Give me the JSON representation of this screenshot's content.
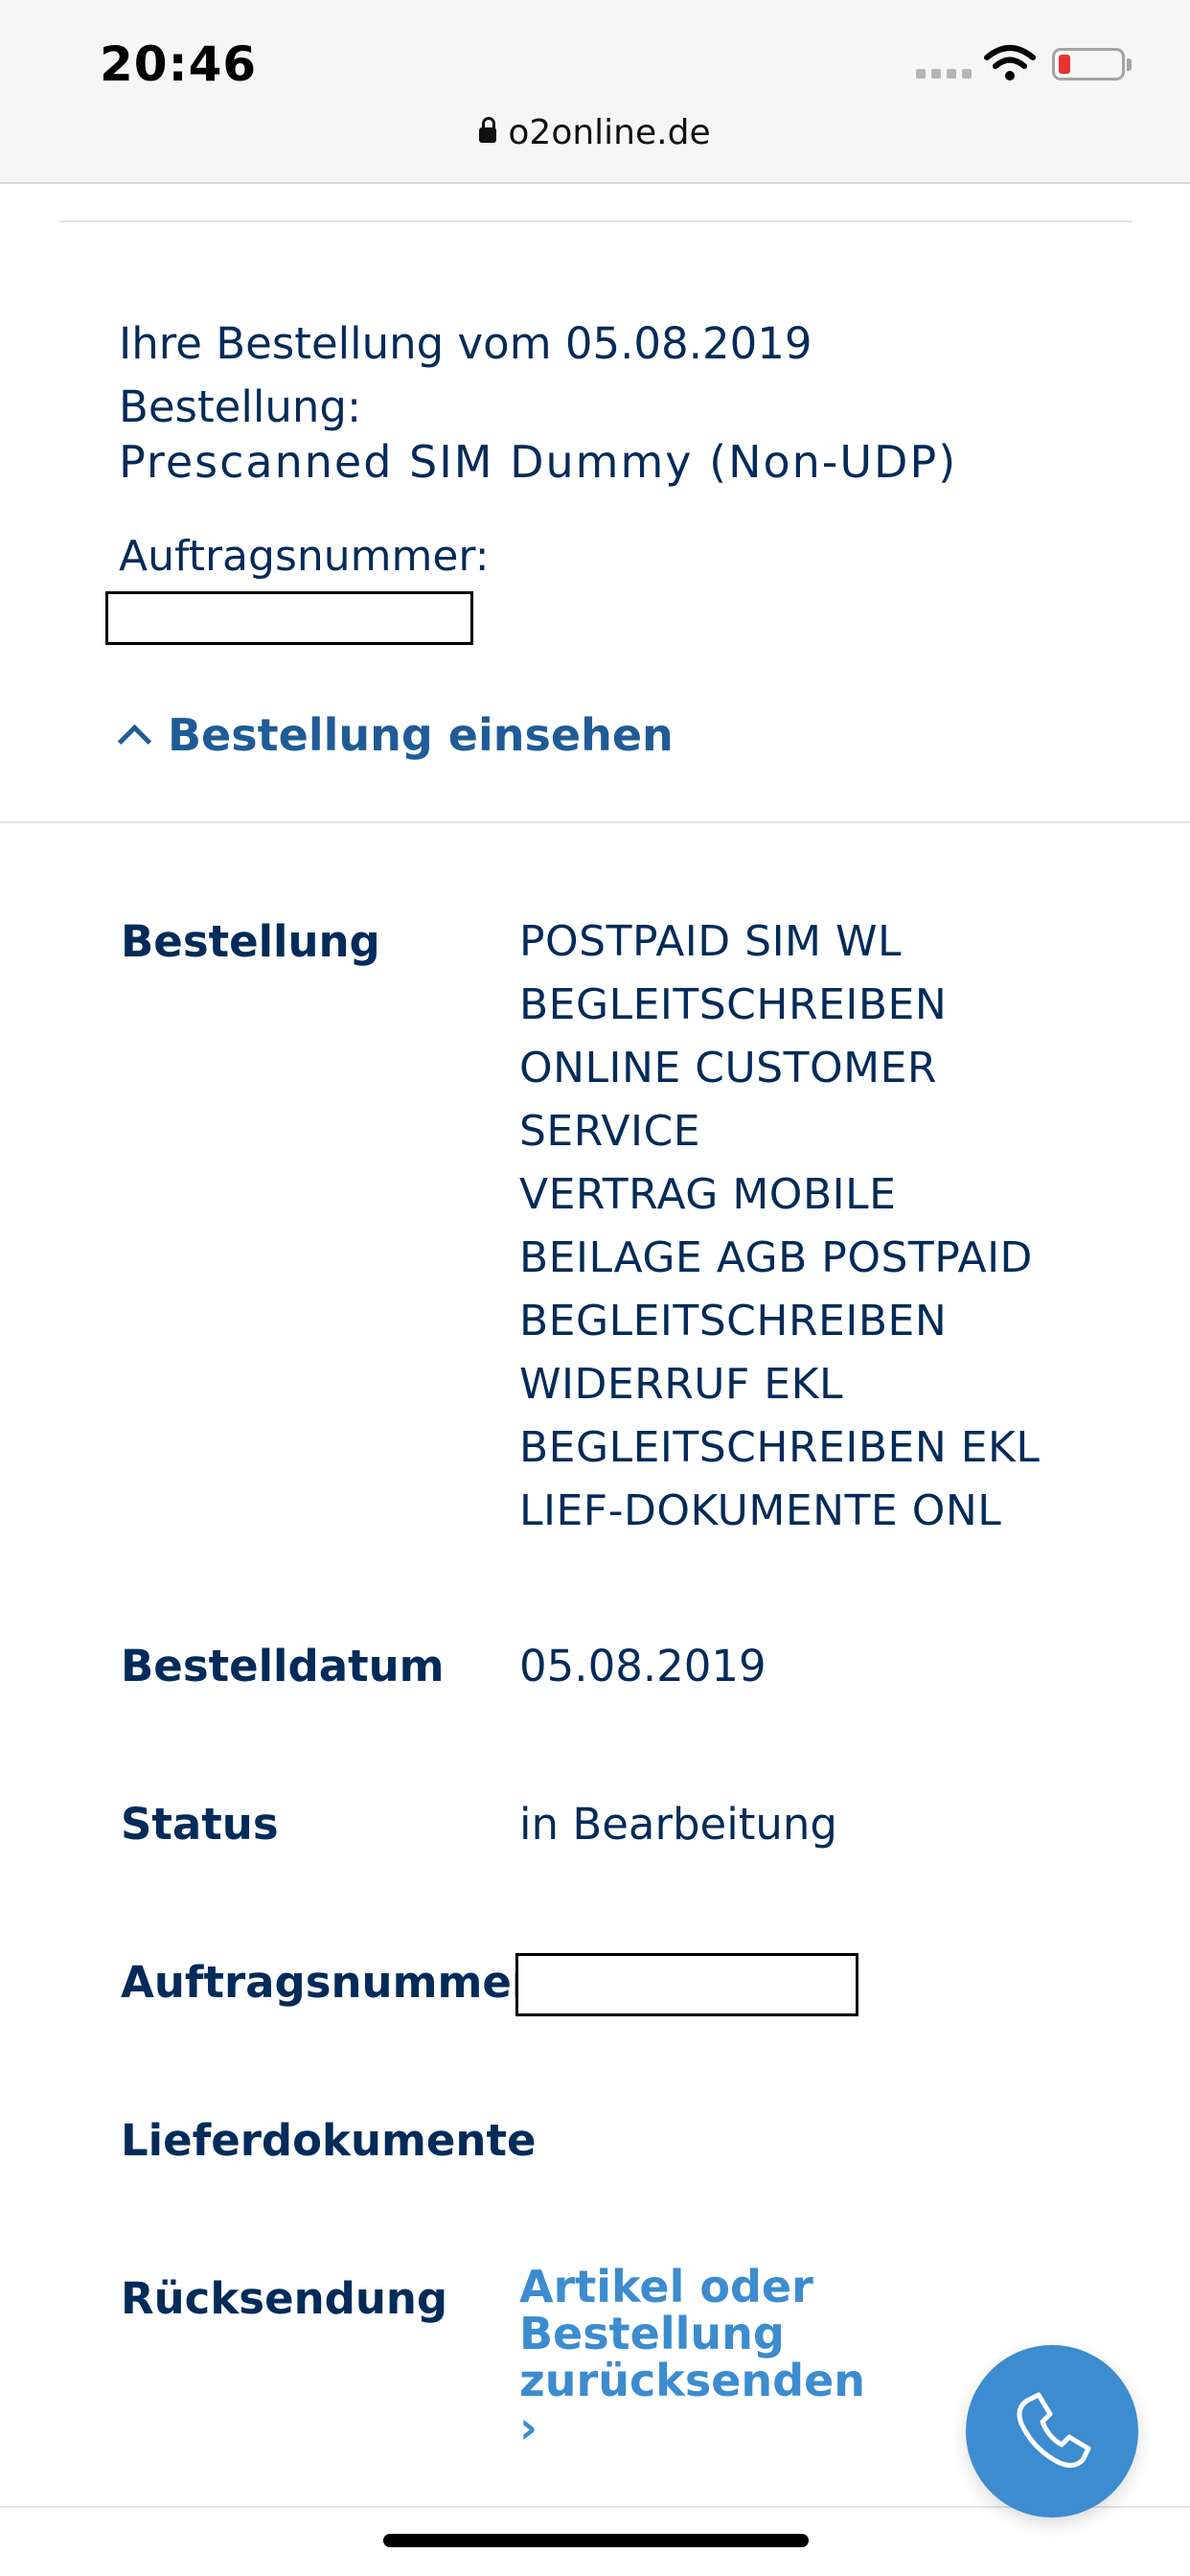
{
  "status_bar": {
    "time": "20:46"
  },
  "browser": {
    "url": "o2online.de"
  },
  "order_summary": {
    "date_line": "Ihre Bestellung vom 05.08.2019",
    "order_label": "Bestellung:",
    "product_name": "Prescanned SIM Dummy (Non-UDP)",
    "order_number_label": "Auftragsnummer:"
  },
  "toggle": {
    "label": "Bestellung einsehen"
  },
  "details": {
    "bestellung_label": "Bestellung",
    "bestellung_items": [
      "POSTPAID SIM WL",
      "BEGLEITSCHREIBEN",
      "ONLINE CUSTOMER",
      "SERVICE",
      "VERTRAG MOBILE",
      "BEILAGE AGB POSTPAID",
      "BEGLEITSCHREIBEN",
      "WIDERRUF EKL",
      "BEGLEITSCHREIBEN EKL",
      "LIEF-DOKUMENTE ONL"
    ],
    "bestelldatum_label": "Bestelldatum",
    "bestelldatum_value": "05.08.2019",
    "status_label": "Status",
    "status_value": "in Bearbeitung",
    "auftragsnummer_label": "Auftragsnummer",
    "lieferdokumente_label": "Lieferdokumente",
    "ruecksendung_label": "Rücksendung",
    "ruecksendung_link": "Artikel oder Bestellung zurücksenden ›"
  },
  "icons": {
    "lock": "lock-icon",
    "wifi": "wifi-icon",
    "battery": "battery-icon",
    "chevron": "chevron-up-icon",
    "phone": "phone-icon"
  },
  "colors": {
    "navy": "#032b5a",
    "link_blue": "#3c8ccf",
    "toggle_blue": "#1f5c97",
    "battery_red": "#e6342e"
  }
}
